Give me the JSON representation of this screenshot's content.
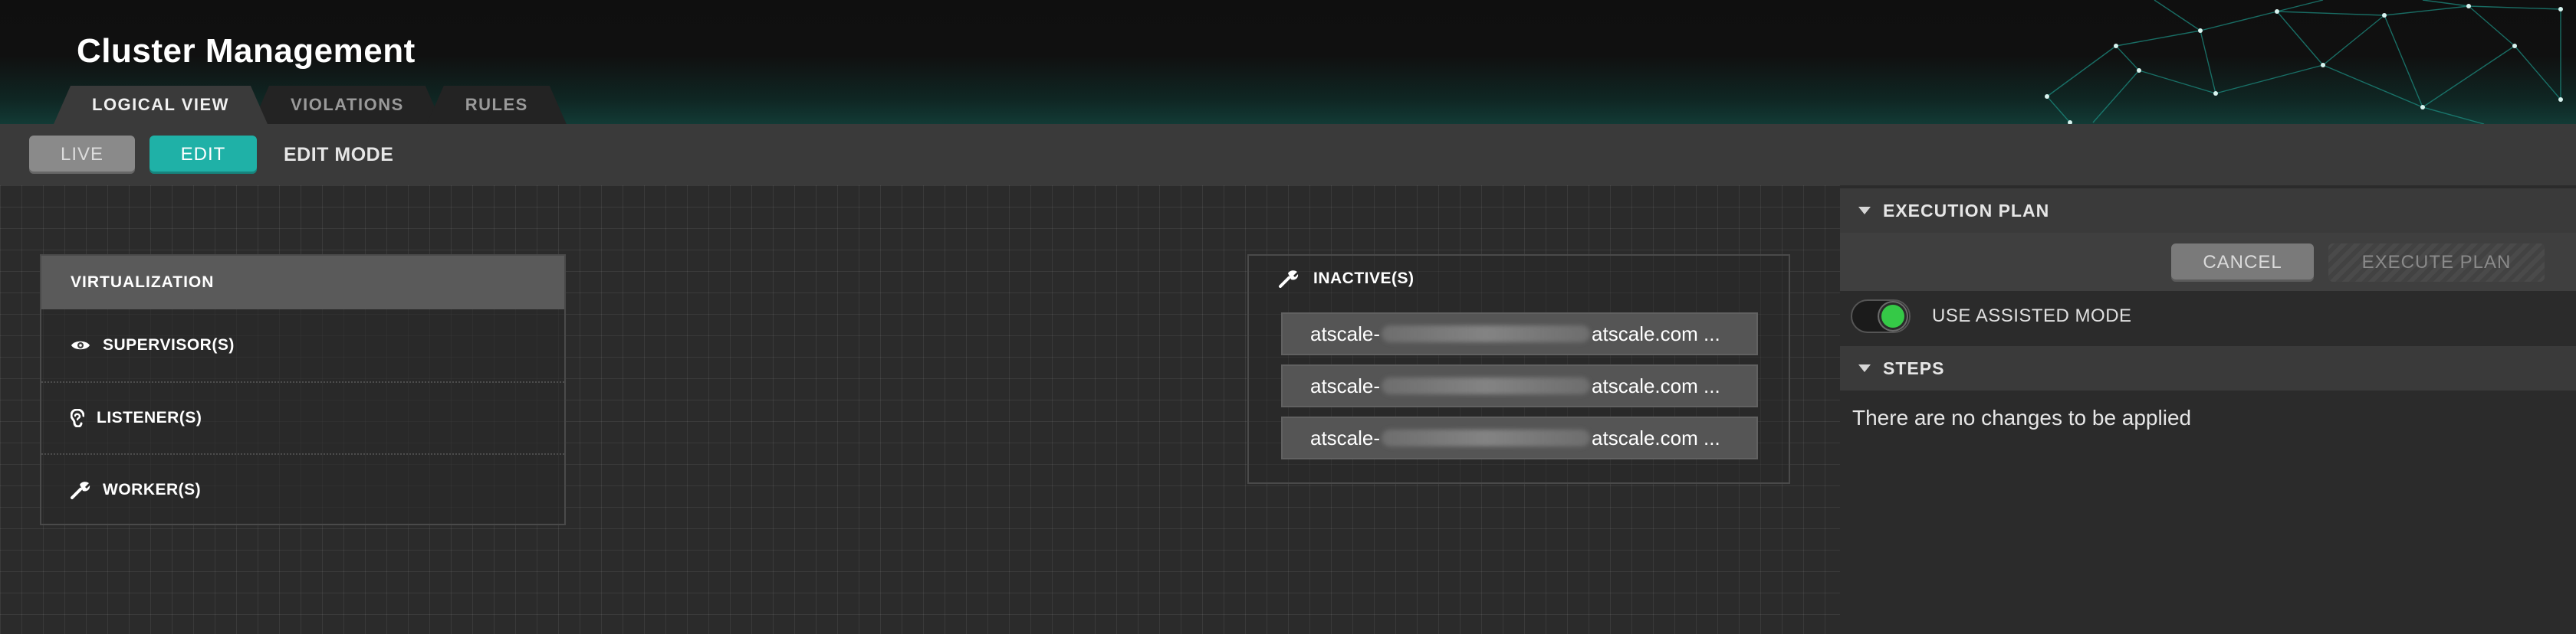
{
  "app": {
    "title": "Cluster Management"
  },
  "tabs": [
    {
      "label": "LOGICAL VIEW",
      "active": true
    },
    {
      "label": "VIOLATIONS",
      "active": false
    },
    {
      "label": "RULES",
      "active": false
    }
  ],
  "toolbar": {
    "live_label": "LIVE",
    "edit_label": "EDIT",
    "mode_label": "EDIT MODE"
  },
  "virtualization": {
    "title": "VIRTUALIZATION",
    "rows": [
      {
        "label": "SUPERVISOR(S)",
        "icon": "eye-icon"
      },
      {
        "label": "LISTENER(S)",
        "icon": "ear-icon"
      },
      {
        "label": "WORKER(S)",
        "icon": "wrench-icon"
      }
    ]
  },
  "inactive": {
    "title": "INACTIVE(S)",
    "icon": "wrench-icon",
    "hosts": [
      {
        "prefix": "atscale-",
        "suffix": "atscale.com",
        "ellipsis": "..."
      },
      {
        "prefix": "atscale-",
        "suffix": "atscale.com",
        "ellipsis": "..."
      },
      {
        "prefix": "atscale-",
        "suffix": "atscale.com",
        "ellipsis": "..."
      }
    ]
  },
  "execution_plan": {
    "title": "EXECUTION PLAN",
    "cancel_label": "CANCEL",
    "execute_label": "EXECUTE PLAN",
    "assisted_label": "USE ASSISTED MODE",
    "assisted_on": true
  },
  "steps": {
    "title": "STEPS",
    "empty_message": "There are no changes to be applied"
  },
  "colors": {
    "accent": "#1fb1a7",
    "toggle_on": "#35c947"
  }
}
